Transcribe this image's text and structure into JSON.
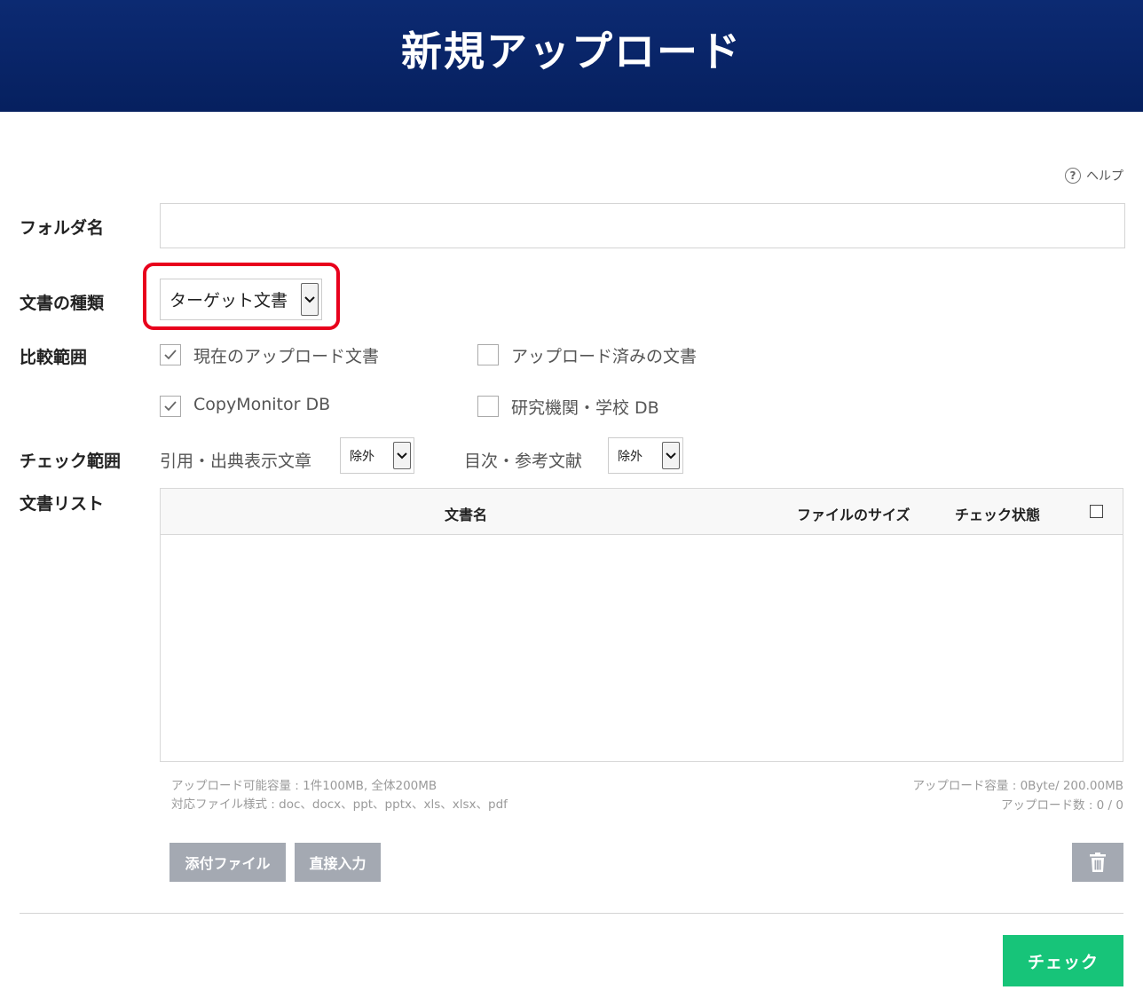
{
  "header": {
    "title": "新規アップロード"
  },
  "help": {
    "label": "ヘルプ",
    "icon": "question-circle-icon"
  },
  "form": {
    "folder_name": {
      "label": "フォルダ名",
      "value": "",
      "placeholder": ""
    },
    "doc_type": {
      "label": "文書の種類",
      "selected": "ターゲット文書"
    },
    "compare_range": {
      "label": "比較範囲",
      "options": [
        {
          "label": "現在のアップロード文書",
          "checked": true
        },
        {
          "label": "アップロード済みの文書",
          "checked": false
        },
        {
          "label": "CopyMonitor DB",
          "checked": true
        },
        {
          "label": "研究機関・学校 DB",
          "checked": false
        }
      ]
    },
    "check_range": {
      "label": "チェック範囲",
      "citation": {
        "label": "引用・出典表示文章",
        "selected": "除外"
      },
      "toc": {
        "label": "目次・参考文献",
        "selected": "除外"
      }
    },
    "doc_list": {
      "label": "文書リスト",
      "columns": [
        "文書名",
        "ファイルのサイズ",
        "チェック状態"
      ],
      "rows": []
    }
  },
  "info": {
    "capacity_limit": "アップロード可能容量 : 1件100MB, 全体200MB",
    "file_formats": "対応ファイル様式 : doc、docx、ppt、pptx、xls、xlsx、pdf",
    "upload_capacity": "アップロード容量 : 0Byte/ 200.00MB",
    "upload_count": "アップロード数 : 0 / 0"
  },
  "buttons": {
    "attach_file": "添付ファイル",
    "direct_input": "直接入力",
    "delete_icon": "trash-icon",
    "check": "チェック"
  },
  "colors": {
    "header_bg": "#0a2566",
    "check_button": "#17c479",
    "gray_button": "#a4a9b2",
    "highlight_border": "#e8001c"
  }
}
